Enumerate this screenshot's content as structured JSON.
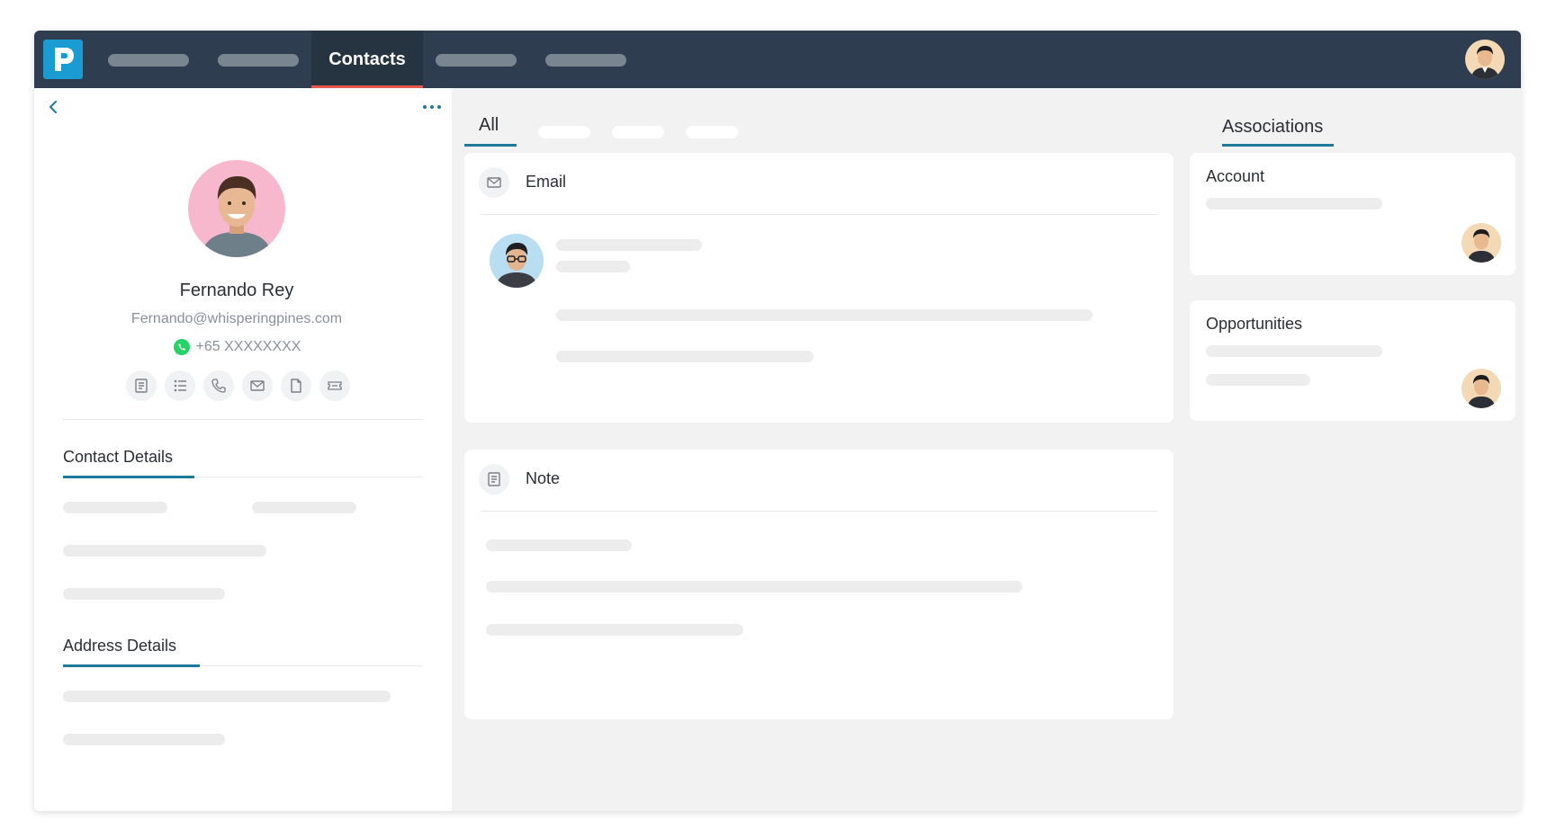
{
  "colors": {
    "topbar": "#2e3d4f",
    "accent_teal": "#1f7a99",
    "active_tab_underline": "#e8574a",
    "logo_bg": "#1a9bd1",
    "whatsapp_green": "#25d366"
  },
  "topbar": {
    "logo_icon": "p-logo-icon",
    "active_nav_label": "Contacts",
    "avatar_icon": "user-avatar-icon"
  },
  "contact": {
    "name": "Fernando Rey",
    "email": "Fernando@whisperingpines.com",
    "phone": "+65 XXXXXXXX",
    "actions": [
      "note-icon",
      "list-icon",
      "phone-icon",
      "email-icon",
      "document-icon",
      "ticket-icon"
    ]
  },
  "left_sections": {
    "contact_details": "Contact Details",
    "address_details": "Address Details"
  },
  "activity": {
    "tab_all": "All",
    "email_card_title": "Email",
    "note_card_title": "Note"
  },
  "associations": {
    "title": "Associations",
    "account_title": "Account",
    "opportunities_title": "Opportunities"
  }
}
